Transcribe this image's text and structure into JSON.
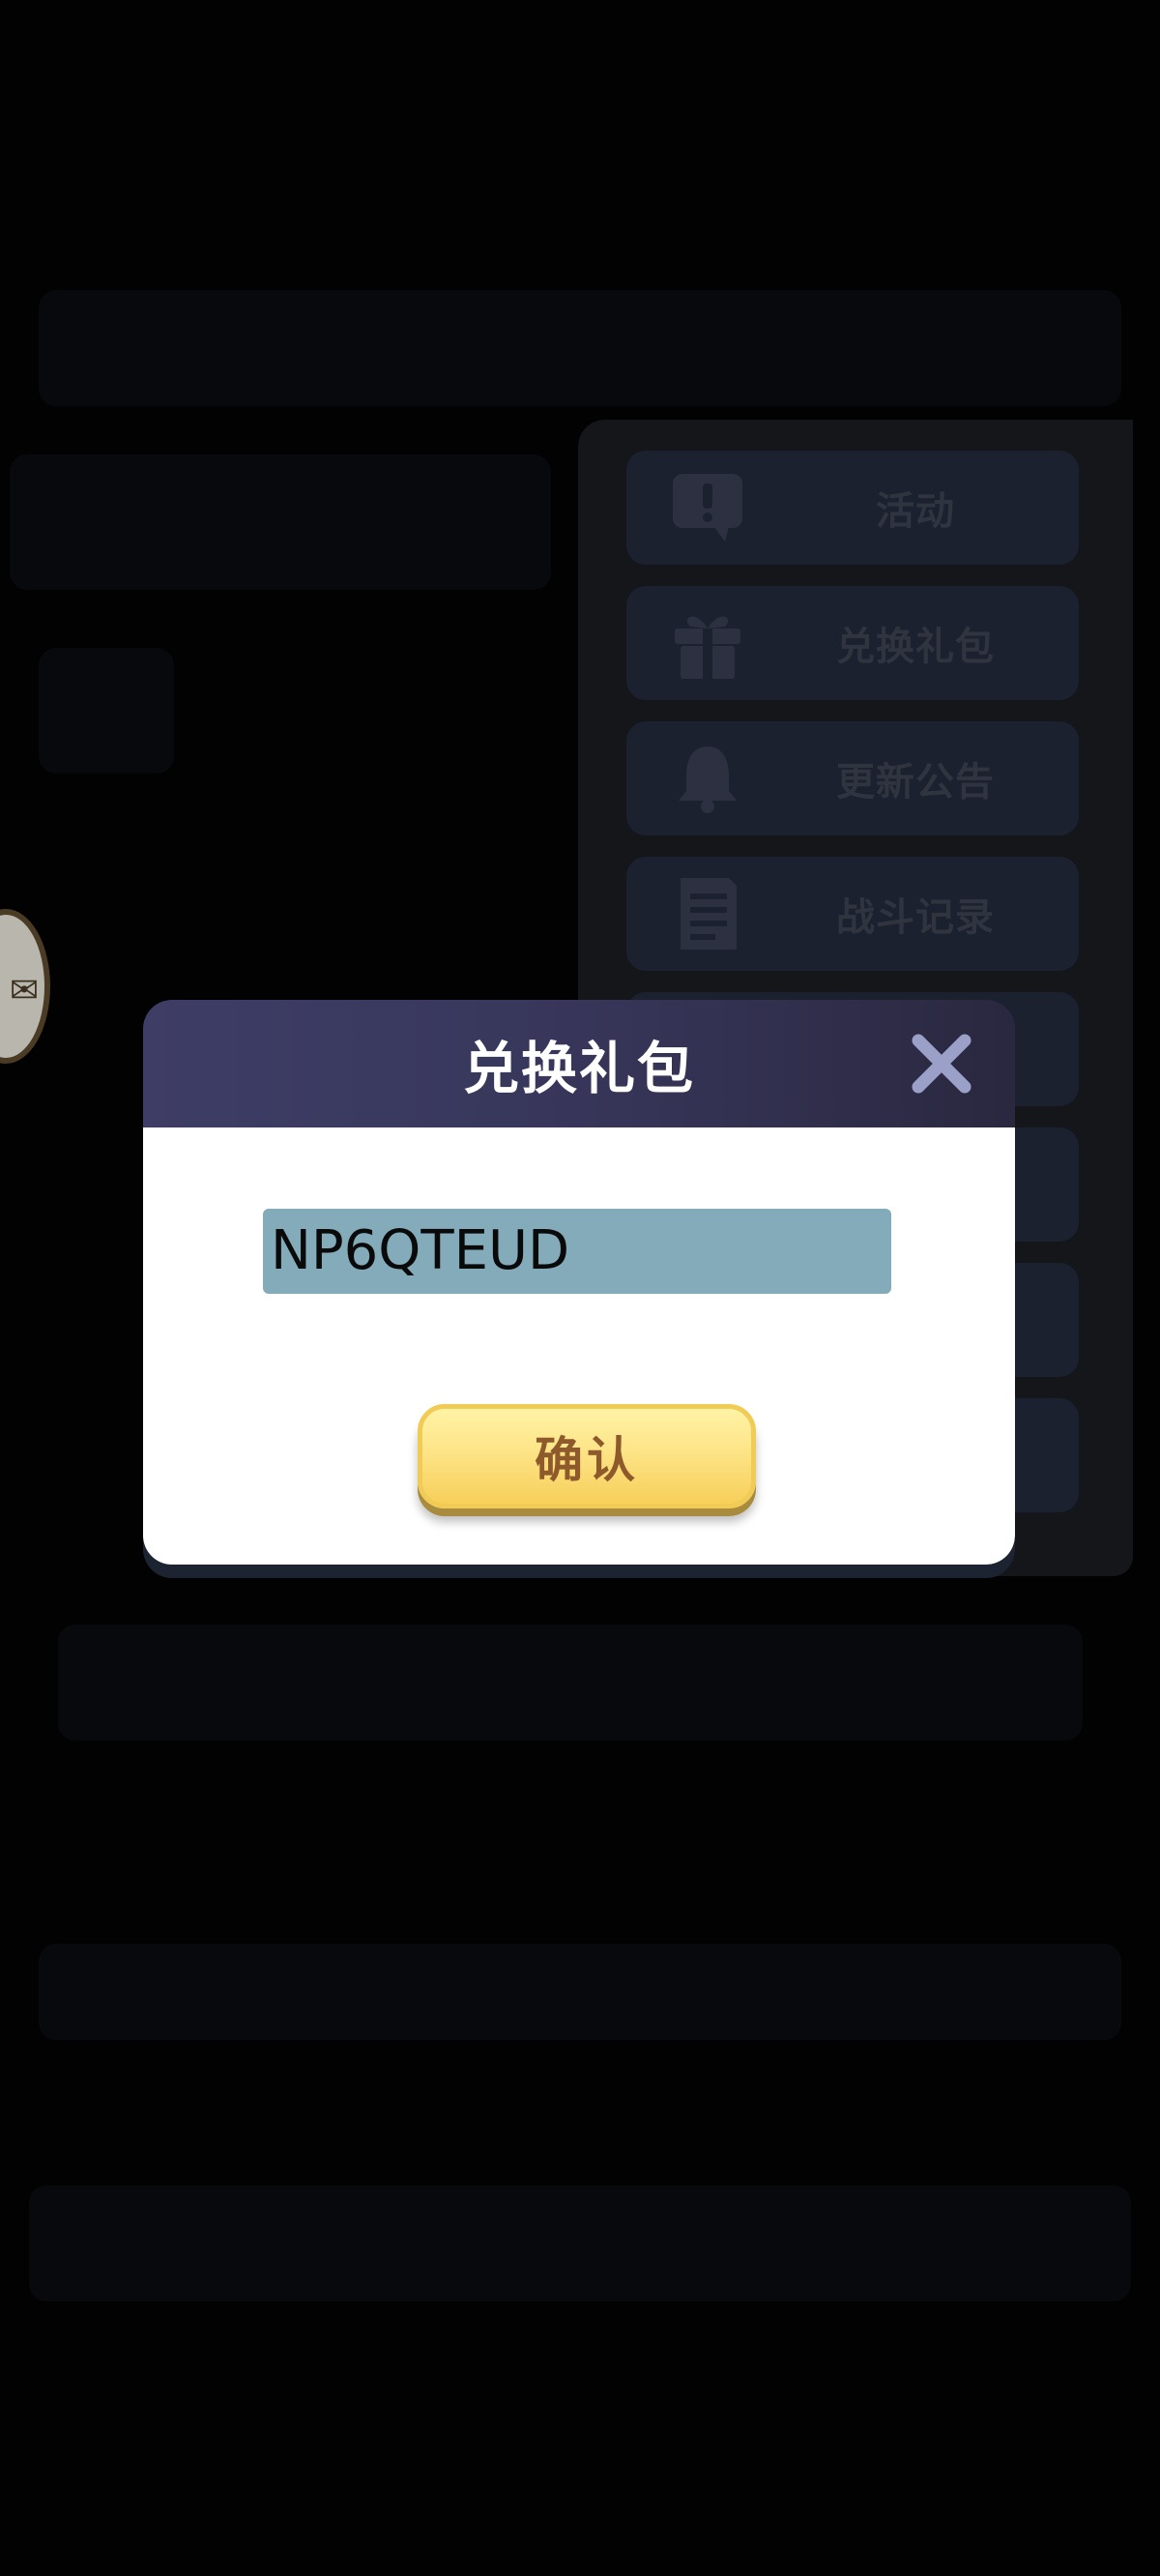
{
  "side_menu": {
    "items": [
      {
        "label": "活动",
        "icon": "exclamation-speech-icon"
      },
      {
        "label": "兑换礼包",
        "icon": "gift-icon"
      },
      {
        "label": "更新公告",
        "icon": "bell-icon"
      },
      {
        "label": "战斗记录",
        "icon": "document-icon"
      },
      {
        "label": "",
        "icon": ""
      },
      {
        "label": "",
        "icon": ""
      },
      {
        "label": "",
        "icon": ""
      },
      {
        "label": "",
        "icon": ""
      }
    ]
  },
  "dialog": {
    "title": "兑换礼包",
    "close_icon": "close-icon",
    "code_value": "NP6QTEUD",
    "confirm_label": "确认"
  },
  "colors": {
    "header": "#3e3d66",
    "input_bg": "#84abba",
    "button_yellow": "#fde487",
    "button_text": "#8e5a2c",
    "close_icon": "#9aa0c8"
  }
}
